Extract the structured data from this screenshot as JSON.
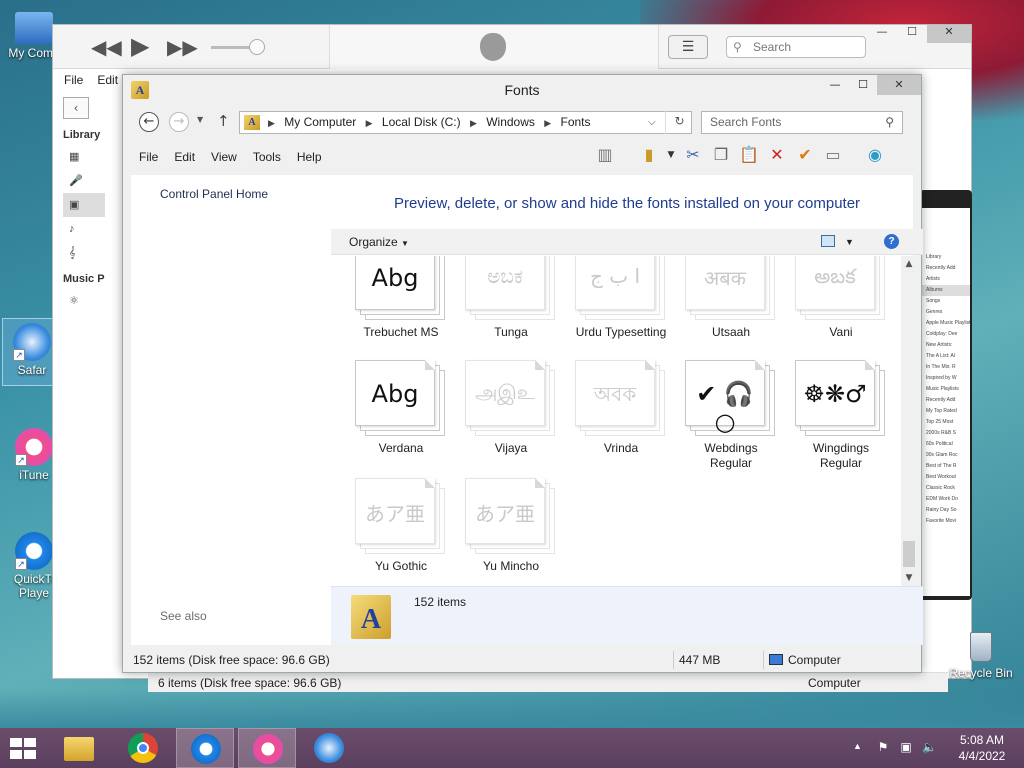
{
  "desktop": {
    "icons": [
      {
        "label": "My Comp",
        "name": "desktop-icon-my-computer"
      },
      {
        "label": "Safar",
        "name": "desktop-icon-safari"
      },
      {
        "label": "iTune",
        "name": "desktop-icon-itunes"
      },
      {
        "label": "QuickTi Playe",
        "name": "desktop-icon-quicktime"
      }
    ],
    "recycle_bin": "Recycle Bin"
  },
  "itunes": {
    "search_placeholder": "Search",
    "menu": [
      "File",
      "Edit"
    ],
    "sidebar_library": "Library",
    "sidebar_music": "Music P",
    "mini_items": [
      "Library",
      "Recently Add",
      "Artists",
      "Albums",
      "Songs",
      "Genres",
      "Apple Music Playlists",
      "Coldplay: Dee",
      "New Artists:",
      "The A List: Al",
      "In The Mix: R",
      "Inspired by W",
      "Music Playlists",
      "Recently Add",
      "My Top Rated",
      "Top 25 Most",
      "2000s R&B S",
      "60s Political",
      "90s Glam Roc",
      "Best of The R",
      "Best Workout",
      "Classic Rock",
      "EDM Work Do",
      "Rainy Day So",
      "Favorite Movi"
    ]
  },
  "background_explorer": {
    "status_left": "6 items (Disk free space: 96.6 GB)",
    "status_right": "Computer"
  },
  "fonts_window": {
    "title": "Fonts",
    "breadcrumb": [
      "My Computer",
      "Local Disk (C:)",
      "Windows",
      "Fonts"
    ],
    "search_placeholder": "Search Fonts",
    "menu": [
      "File",
      "Edit",
      "View",
      "Tools",
      "Help"
    ],
    "left_pane": {
      "control_panel_home": "Control Panel Home",
      "see_also": "See also"
    },
    "heading": "Preview, delete, or show and hide the fonts installed on your computer",
    "organize": "Organize",
    "fonts": [
      {
        "name": "Trebuchet MS",
        "sample": "Abg",
        "faded": false
      },
      {
        "name": "Tunga",
        "sample": "ಅಬಕ",
        "faded": true
      },
      {
        "name": "Urdu Typesetting",
        "sample": "ا ب ج",
        "faded": true
      },
      {
        "name": "Utsaah",
        "sample": "अबक",
        "faded": true
      },
      {
        "name": "Vani",
        "sample": "అబక",
        "faded": true
      },
      {
        "name": "Verdana",
        "sample": "Abg",
        "faded": false
      },
      {
        "name": "Vijaya",
        "sample": "அஇஉ",
        "faded": true
      },
      {
        "name": "Vrinda",
        "sample": "অবক",
        "faded": true
      },
      {
        "name": "Webdings Regular",
        "sample": "✔ 🎧 ○",
        "faded": false
      },
      {
        "name": "Wingdings Regular",
        "sample": "☸❋♂",
        "faded": false
      },
      {
        "name": "Yu Gothic",
        "sample": "あア亜",
        "faded": true
      },
      {
        "name": "Yu Mincho",
        "sample": "あア亜",
        "faded": true
      }
    ],
    "details_count": "152 items",
    "status": {
      "items": "152 items (Disk free space: 96.6 GB)",
      "size": "447 MB",
      "location": "Computer"
    }
  },
  "taskbar": {
    "time": "5:08 AM",
    "date": "4/4/2022"
  }
}
